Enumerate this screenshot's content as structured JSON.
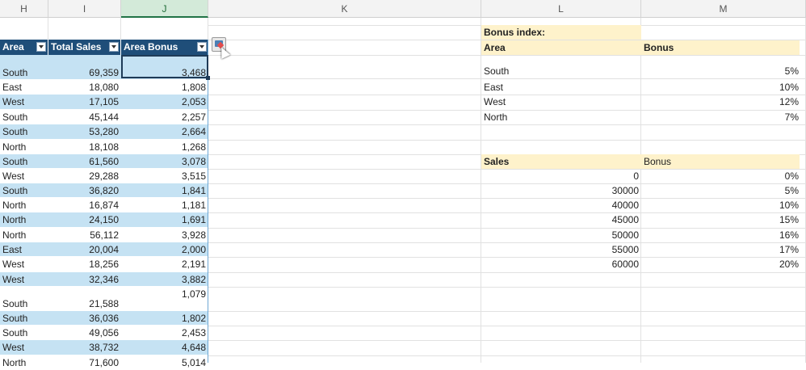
{
  "columns": [
    {
      "key": "H",
      "label": "H"
    },
    {
      "key": "I",
      "label": "I"
    },
    {
      "key": "J",
      "label": "J"
    },
    {
      "key": "K",
      "label": "K"
    },
    {
      "key": "L",
      "label": "L"
    },
    {
      "key": "M",
      "label": "M"
    }
  ],
  "selected_column": "J",
  "table": {
    "headers": [
      "Area",
      "Total Sales",
      "Area Bonus"
    ],
    "rows": [
      {
        "area": "South",
        "sales": "69,359",
        "bonus": "3,468"
      },
      {
        "area": "East",
        "sales": "18,080",
        "bonus": "1,808"
      },
      {
        "area": "West",
        "sales": "17,105",
        "bonus": "2,053"
      },
      {
        "area": "South",
        "sales": "45,144",
        "bonus": "2,257"
      },
      {
        "area": "South",
        "sales": "53,280",
        "bonus": "2,664"
      },
      {
        "area": "North",
        "sales": "18,108",
        "bonus": "1,268"
      },
      {
        "area": "South",
        "sales": "61,560",
        "bonus": "3,078"
      },
      {
        "area": "West",
        "sales": "29,288",
        "bonus": "3,515"
      },
      {
        "area": "South",
        "sales": "36,820",
        "bonus": "1,841"
      },
      {
        "area": "North",
        "sales": "16,874",
        "bonus": "1,181"
      },
      {
        "area": "North",
        "sales": "24,150",
        "bonus": "1,691"
      },
      {
        "area": "North",
        "sales": "56,112",
        "bonus": "3,928"
      },
      {
        "area": "East",
        "sales": "20,004",
        "bonus": "2,000"
      },
      {
        "area": "West",
        "sales": "18,256",
        "bonus": "2,191"
      },
      {
        "area": "West",
        "sales": "32,346",
        "bonus": "3,882"
      },
      {
        "area": "South",
        "sales": "21,588",
        "bonus": "1,079"
      },
      {
        "area": "South",
        "sales": "36,036",
        "bonus": "1,802"
      },
      {
        "area": "South",
        "sales": "49,056",
        "bonus": "2,453"
      },
      {
        "area": "West",
        "sales": "38,732",
        "bonus": "4,648"
      },
      {
        "area": "North",
        "sales": "71,600",
        "bonus": "5,014"
      }
    ]
  },
  "bonus_index": {
    "title": "Bonus index:",
    "header_area": "Area",
    "header_bonus": "Bonus",
    "rows": [
      {
        "area": "South",
        "bonus": "5%"
      },
      {
        "area": "East",
        "bonus": "10%"
      },
      {
        "area": "West",
        "bonus": "12%"
      },
      {
        "area": "North",
        "bonus": "7%"
      }
    ]
  },
  "sales_bonus": {
    "header_sales": "Sales",
    "header_bonus": "Bonus",
    "rows": [
      {
        "sales": "0",
        "bonus": "0%"
      },
      {
        "sales": "30000",
        "bonus": "5%"
      },
      {
        "sales": "40000",
        "bonus": "10%"
      },
      {
        "sales": "45000",
        "bonus": "15%"
      },
      {
        "sales": "50000",
        "bonus": "16%"
      },
      {
        "sales": "55000",
        "bonus": "17%"
      },
      {
        "sales": "60000",
        "bonus": "20%"
      }
    ]
  },
  "colors": {
    "table_header": "#1f4e79",
    "band": "#c5e2f3",
    "yellow": "#fef2cb",
    "selected_col": "#d3ead9"
  },
  "icons": {
    "quick_analysis": "quick-analysis-icon",
    "filter": "filter-dropdown-icon",
    "cursor": "mouse-cursor-icon"
  }
}
